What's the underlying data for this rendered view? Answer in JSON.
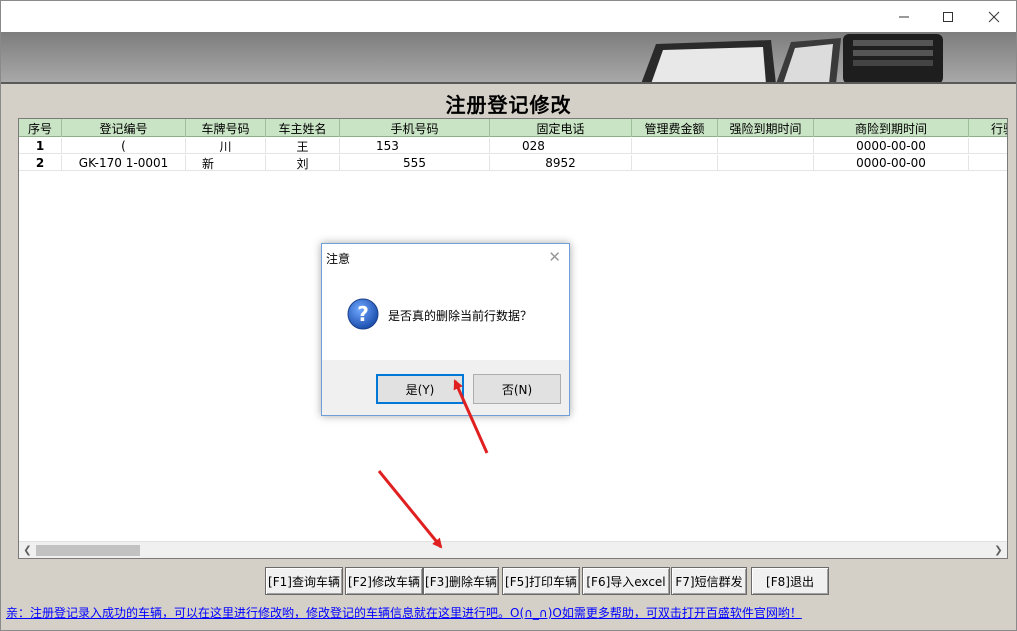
{
  "window": {
    "minimize_icon": "minimize-icon",
    "maximize_icon": "maximize-icon",
    "close_icon": "close-icon"
  },
  "page_title": "注册登记修改",
  "grid": {
    "columns": [
      "序号",
      "登记编号",
      "车牌号码",
      "车主姓名",
      "手机号码",
      "固定电话",
      "管理费金额",
      "强险到期时间",
      "商险到期时间",
      "行驶"
    ],
    "rows": [
      [
        "1",
        "(",
        "川",
        "王",
        "153",
        "028",
        "",
        "",
        "0000-00-00"
      ],
      [
        "2",
        "GK-170        1-0001",
        "新",
        "刘",
        "555",
        "8952",
        "",
        "",
        "0000-00-00"
      ]
    ]
  },
  "buttons": {
    "f1": "[F1]查询车辆",
    "f2": "[F2]修改车辆",
    "f3": "[F3]删除车辆",
    "f5": "[F5]打印车辆",
    "f6": "[F6]导入excel",
    "f7": "F7]短信群发",
    "f8": "[F8]退出"
  },
  "status_text": "亲：注册登记录入成功的车辆，可以在这里进行修改哟，修改登记的车辆信息就在这里进行吧。O(∩_∩)O如需更多帮助，可双击打开百盛软件官网哟！",
  "dialog": {
    "title": "注意",
    "message": "是否真的删除当前行数据？",
    "yes_label": "是(Y)",
    "no_label": "否(N)",
    "icon": "question-icon"
  },
  "colors": {
    "grid_header": "#c9e3c5",
    "status_link": "#0000ff",
    "annotation_arrow": "#e02020"
  }
}
